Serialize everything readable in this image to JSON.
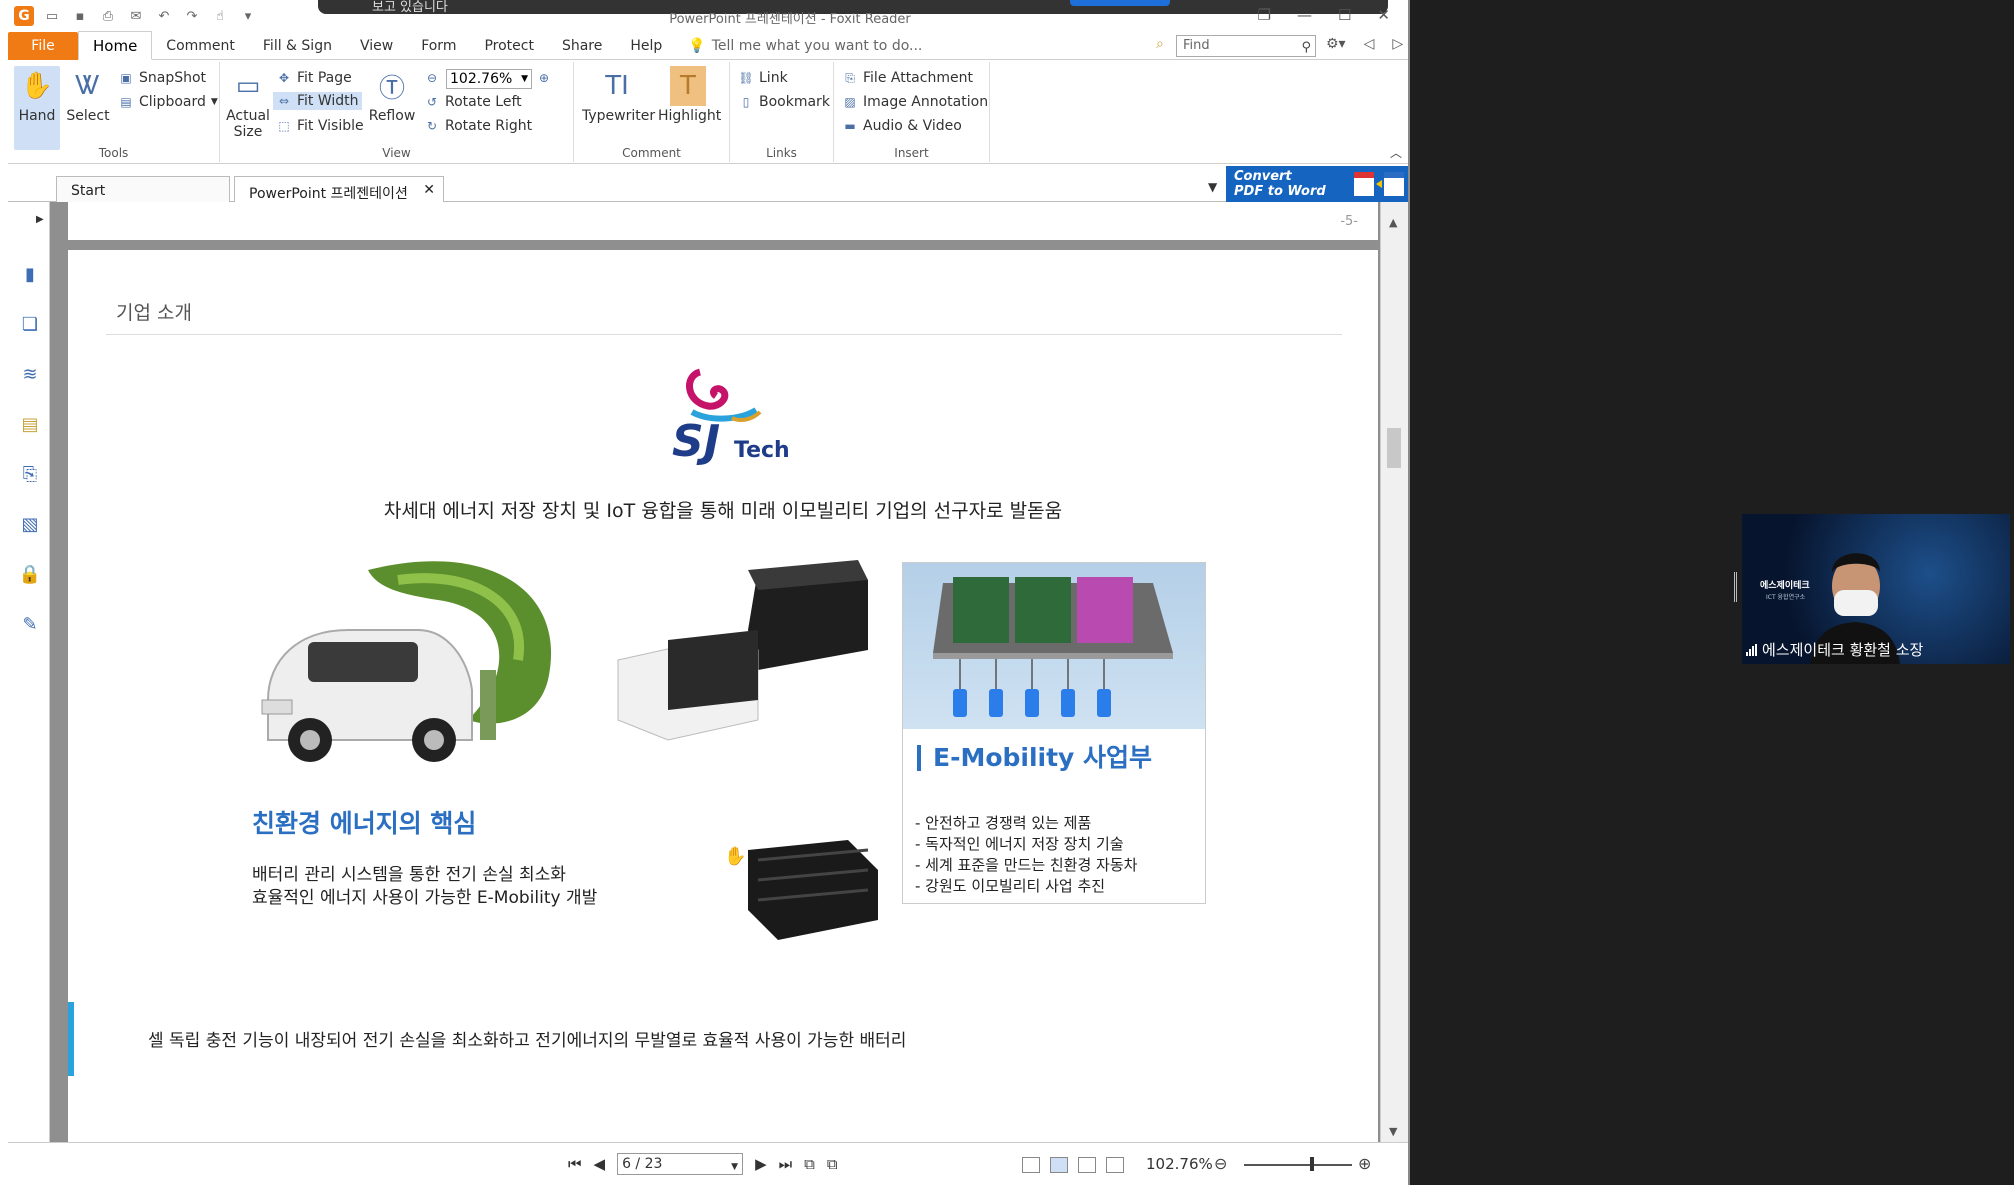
{
  "window": {
    "title": "PowerPoint 프레젠테이션 - Foxit Reader",
    "notification": "보고 있습니다"
  },
  "menu": {
    "file": "File",
    "items": [
      "Home",
      "Comment",
      "Fill & Sign",
      "View",
      "Form",
      "Protect",
      "Share",
      "Help"
    ],
    "active": "Home",
    "tellme": "Tell me what you want to do...",
    "find_placeholder": "Find"
  },
  "ribbon": {
    "tools": {
      "label": "Tools",
      "hand": "Hand",
      "select": "Select",
      "snapshot": "SnapShot",
      "clipboard": "Clipboard"
    },
    "view": {
      "label": "View",
      "actual_size_1": "Actual",
      "actual_size_2": "Size",
      "fit_page": "Fit Page",
      "fit_width": "Fit Width",
      "fit_visible": "Fit Visible",
      "reflow": "Reflow",
      "zoom": "102.76%",
      "rotate_left": "Rotate Left",
      "rotate_right": "Rotate Right"
    },
    "comment": {
      "label": "Comment",
      "typewriter": "Typewriter",
      "highlight": "Highlight"
    },
    "links": {
      "label": "Links",
      "link": "Link",
      "bookmark": "Bookmark"
    },
    "insert": {
      "label": "Insert",
      "file_attachment": "File Attachment",
      "image_annotation": "Image Annotation",
      "audio_video": "Audio & Video"
    }
  },
  "tabs": [
    {
      "label": "Start"
    },
    {
      "label": "PowerPoint 프레젠테이션"
    }
  ],
  "convert": {
    "line1": "Convert",
    "line2": "PDF to Word"
  },
  "page_number_prev": "-5-",
  "slide": {
    "section_title": "기업 소개",
    "logo_text_sj": "SJ",
    "logo_text_tech": "Tech",
    "tagline": "차세대 에너지 저장 장치 및 IoT 융합을 통해 미래 이모빌리티 기업의 선구자로 발돋움",
    "eco_title": "친환경 에너지의 핵심",
    "eco_line1": "배터리 관리 시스템을 통한 전기 손실 최소화",
    "eco_line2": "효율적인 에너지 사용이 가능한 E-Mobility 개발",
    "emob_title": "E-Mobility 사업부",
    "emob_items": [
      "-   안전하고 경쟁력 있는 제품",
      "-   독자적인 에너지 저장 장치 기술",
      "-   세계 표준을 만드는 친환경 자동차",
      "-   강원도 이모빌리티 사업 추진"
    ],
    "bottom_text": "셀 독립 충전 기능이 내장되어 전기 손실을 최소화하고 전기에너지의 무발열로 효율적 사용이 가능한 배터리"
  },
  "status": {
    "page": "6 / 23",
    "zoom": "102.76%"
  },
  "video": {
    "caption": "에스제이테크 황환철 소장",
    "brand": "에스제이테크",
    "brand_sub": "ICT 융합연구소"
  },
  "colors": {
    "accent_orange": "#f07b14",
    "ribbon_select": "#cfe0f6",
    "slide_blue": "#2a6fc1",
    "convert_blue": "#1565c0"
  }
}
